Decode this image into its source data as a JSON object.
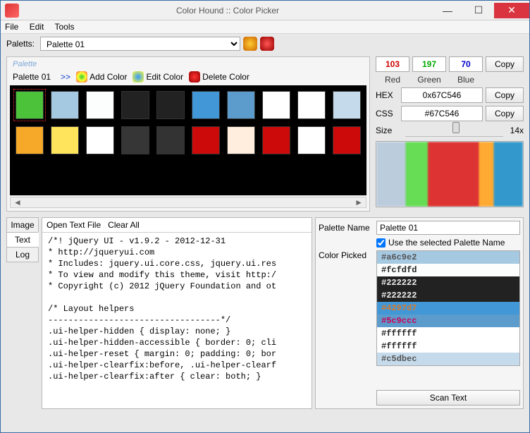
{
  "window": {
    "title": "Color Hound :: Color Picker"
  },
  "menu": {
    "file": "File",
    "edit": "Edit",
    "tools": "Tools"
  },
  "toolbar": {
    "paletts_label": "Paletts:",
    "palette_select": "Palette 01"
  },
  "palette": {
    "group_title": "Palette",
    "name": "Palette 01",
    "arrows": ">>",
    "add": "Add Color",
    "editc": "Edit Color",
    "del": "Delete Color",
    "row1": [
      "#4cc23b",
      "#a6c9e2",
      "#fcfdfd",
      "#222222",
      "#222222",
      "#4297d7",
      "#5c9ccc",
      "#ffffff",
      "#ffffff",
      "#c5dbec"
    ],
    "row2": [
      "#f6a828",
      "#ffe45c",
      "#ffffff",
      "#363636",
      "#333333",
      "#cd0a0a",
      "#ffeedd",
      "#cd0a0a",
      "#ffffff",
      "#cd0a0a"
    ]
  },
  "picker": {
    "r": "103",
    "g": "197",
    "b": "70",
    "red_lbl": "Red",
    "green_lbl": "Green",
    "blue_lbl": "Blue",
    "hex_lbl": "HEX",
    "hex_val": "0x67C546",
    "css_lbl": "CSS",
    "css_val": "#67C546",
    "copy": "Copy",
    "size_lbl": "Size",
    "zoom": "14x"
  },
  "tabs": {
    "image": "Image",
    "text": "Text",
    "log": "Log",
    "open": "Open Text File",
    "clear": "Clear All"
  },
  "text_lines": [
    "/*! jQuery UI - v1.9.2 - 2012-12-31",
    "* http://jqueryui.com",
    "* Includes: jquery.ui.core.css, jquery.ui.res",
    "* To view and modify this theme, visit http:/",
    "* Copyright (c) 2012 jQuery Foundation and ot",
    "",
    "/* Layout helpers",
    "----------------------------------*/",
    ".ui-helper-hidden { display: none; }",
    ".ui-helper-hidden-accessible { border: 0; cli",
    ".ui-helper-reset { margin: 0; padding: 0; bor",
    ".ui-helper-clearfix:before, .ui-helper-clearf",
    ".ui-helper-clearfix:after { clear: both; }"
  ],
  "scan": {
    "pname_lbl": "Palette Name",
    "pname_val": "Palette 01",
    "use_cb": "Use the selected Palette Name",
    "picked_lbl": "Color Picked",
    "scan_btn": "Scan Text",
    "picked": [
      {
        "hex": "#a6c9e2",
        "bg": "#a6c9e2",
        "fg": "#555"
      },
      {
        "hex": "#fcfdfd",
        "bg": "#fcfdfd",
        "fg": "#222"
      },
      {
        "hex": "#222222",
        "bg": "#222222",
        "fg": "#eee"
      },
      {
        "hex": "#222222",
        "bg": "#222222",
        "fg": "#eee"
      },
      {
        "hex": "#4297d7",
        "bg": "#4297d7",
        "fg": "#d87a2a"
      },
      {
        "hex": "#5c9ccc",
        "bg": "#5c9ccc",
        "fg": "#c05"
      },
      {
        "hex": "#ffffff",
        "bg": "#ffffff",
        "fg": "#222"
      },
      {
        "hex": "#ffffff",
        "bg": "#ffffff",
        "fg": "#222"
      },
      {
        "hex": "#c5dbec",
        "bg": "#c5dbec",
        "fg": "#555"
      }
    ]
  }
}
